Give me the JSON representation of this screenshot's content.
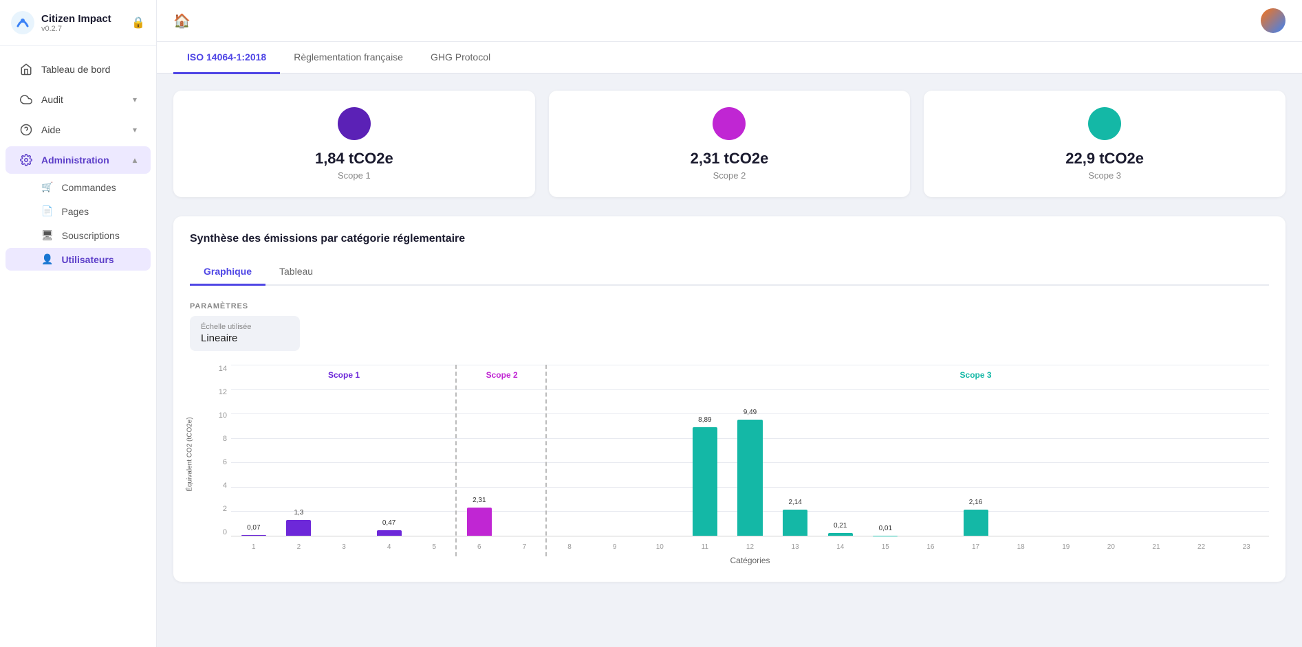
{
  "app": {
    "name": "Citizen Impact",
    "version": "v0.2.7"
  },
  "sidebar": {
    "nav_items": [
      {
        "id": "tableau-de-bord",
        "label": "Tableau de bord",
        "icon": "home",
        "active": false
      },
      {
        "id": "audit",
        "label": "Audit",
        "icon": "cloud",
        "active": false,
        "expandable": true
      },
      {
        "id": "aide",
        "label": "Aide",
        "icon": "help",
        "active": false,
        "expandable": true
      },
      {
        "id": "administration",
        "label": "Administration",
        "icon": "gear",
        "active": true,
        "expandable": true
      }
    ],
    "sub_items": [
      {
        "id": "commandes",
        "label": "Commandes",
        "icon": "cart"
      },
      {
        "id": "pages",
        "label": "Pages",
        "icon": "file"
      },
      {
        "id": "souscriptions",
        "label": "Souscriptions",
        "icon": "monitor"
      },
      {
        "id": "utilisateurs",
        "label": "Utilisateurs",
        "icon": "person",
        "active": true
      }
    ]
  },
  "tabs": [
    {
      "id": "iso",
      "label": "ISO 14064-1:2018",
      "active": true
    },
    {
      "id": "french",
      "label": "Règlementation française",
      "active": false
    },
    {
      "id": "ghg",
      "label": "GHG Protocol",
      "active": false
    }
  ],
  "scopes": [
    {
      "id": "scope1",
      "value": "1,84 tCO2e",
      "label": "Scope 1",
      "color": "#5b21b6"
    },
    {
      "id": "scope2",
      "value": "2,31 tCO2e",
      "label": "Scope 2",
      "color": "#c026d3"
    },
    {
      "id": "scope3",
      "value": "22,9 tCO2e",
      "label": "Scope 3",
      "color": "#14b8a6"
    }
  ],
  "synthesis": {
    "title": "Synthèse des émissions par catégorie réglementaire",
    "chart_tabs": [
      {
        "id": "graphique",
        "label": "Graphique",
        "active": true
      },
      {
        "id": "tableau",
        "label": "Tableau",
        "active": false
      }
    ],
    "params_section_label": "PARAMÈTRES",
    "scale_label": "Échelle utilisée",
    "scale_value": "Lineaire",
    "y_axis_label": "Équivalent CO2 (tCO2e)",
    "x_axis_label": "Catégories",
    "y_max": 14,
    "y_ticks": [
      14,
      12,
      10,
      8,
      6,
      4,
      2,
      0
    ],
    "scope_labels": [
      {
        "label": "Scope 1",
        "color": "#6d28d9",
        "start_col": 2,
        "end_col": 5
      },
      {
        "label": "Scope 2",
        "color": "#c026d3",
        "start_col": 6,
        "end_col": 7
      },
      {
        "label": "Scope 3",
        "color": "#14b8a6",
        "start_col": 11,
        "end_col": 23
      }
    ],
    "bars": [
      {
        "cat": "1",
        "value": 0.07,
        "color": "#6d28d9",
        "label": "0,07"
      },
      {
        "cat": "2",
        "value": 1.3,
        "color": "#6d28d9",
        "label": "1,3"
      },
      {
        "cat": "3",
        "value": 0,
        "color": "#6d28d9",
        "label": ""
      },
      {
        "cat": "4",
        "value": 0.47,
        "color": "#6d28d9",
        "label": "0,47"
      },
      {
        "cat": "5",
        "value": 0,
        "color": "#6d28d9",
        "label": ""
      },
      {
        "cat": "6",
        "value": 2.31,
        "color": "#c026d3",
        "label": "2,31"
      },
      {
        "cat": "7",
        "value": 0,
        "color": "#c026d3",
        "label": ""
      },
      {
        "cat": "8",
        "value": 0,
        "color": "#14b8a6",
        "label": ""
      },
      {
        "cat": "9",
        "value": 0,
        "color": "#14b8a6",
        "label": ""
      },
      {
        "cat": "10",
        "value": 0,
        "color": "#14b8a6",
        "label": ""
      },
      {
        "cat": "11",
        "value": 8.89,
        "color": "#14b8a6",
        "label": "8,89"
      },
      {
        "cat": "12",
        "value": 9.49,
        "color": "#14b8a6",
        "label": "9,49"
      },
      {
        "cat": "13",
        "value": 2.14,
        "color": "#14b8a6",
        "label": "2,14"
      },
      {
        "cat": "14",
        "value": 0.21,
        "color": "#14b8a6",
        "label": "0,21"
      },
      {
        "cat": "15",
        "value": 0.01,
        "color": "#14b8a6",
        "label": "0,01"
      },
      {
        "cat": "16",
        "value": 0,
        "color": "#14b8a6",
        "label": ""
      },
      {
        "cat": "17",
        "value": 2.16,
        "color": "#14b8a6",
        "label": "2,16"
      },
      {
        "cat": "18",
        "value": 0,
        "color": "#14b8a6",
        "label": ""
      },
      {
        "cat": "19",
        "value": 0,
        "color": "#14b8a6",
        "label": ""
      },
      {
        "cat": "20",
        "value": 0,
        "color": "#14b8a6",
        "label": ""
      },
      {
        "cat": "21",
        "value": 0,
        "color": "#14b8a6",
        "label": ""
      },
      {
        "cat": "22",
        "value": 0,
        "color": "#14b8a6",
        "label": ""
      },
      {
        "cat": "23",
        "value": 0,
        "color": "#14b8a6",
        "label": ""
      }
    ]
  }
}
